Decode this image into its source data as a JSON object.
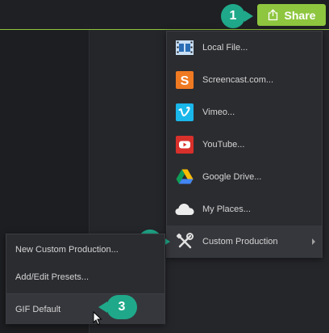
{
  "share_button": {
    "label": "Share",
    "icon": "share-upload-icon",
    "color": "#8ec63f"
  },
  "callouts": {
    "c1": "1",
    "c2": "2",
    "c3": "3",
    "color": "#1fa98a"
  },
  "share_menu": {
    "items": [
      {
        "label": "Local File...",
        "icon": "film-icon"
      },
      {
        "label": "Screencast.com...",
        "icon": "screencast-icon"
      },
      {
        "label": "Vimeo...",
        "icon": "vimeo-icon"
      },
      {
        "label": "YouTube...",
        "icon": "youtube-icon"
      },
      {
        "label": "Google Drive...",
        "icon": "google-drive-icon"
      },
      {
        "label": "My Places...",
        "icon": "cloud-icon"
      },
      {
        "label": "Custom Production",
        "icon": "tools-icon"
      }
    ]
  },
  "custom_submenu": {
    "items": [
      {
        "label": "New Custom Production..."
      },
      {
        "label": "Add/Edit Presets..."
      },
      {
        "label": "GIF Default"
      }
    ]
  }
}
